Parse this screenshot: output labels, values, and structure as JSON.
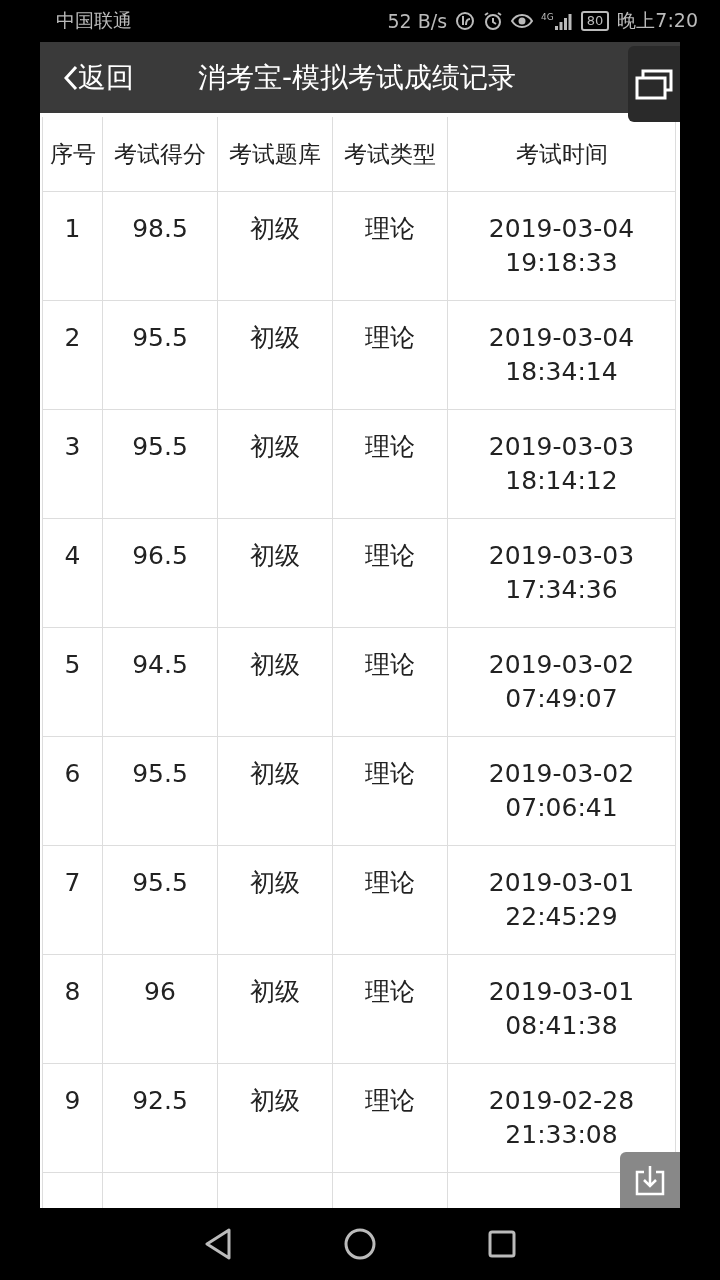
{
  "status_bar": {
    "carrier": "中国联通",
    "speed": "52 B/s",
    "network": "4G",
    "battery": "80",
    "time": "晚上7:20"
  },
  "header": {
    "back": "返回",
    "title": "消考宝-模拟考试成绩记录"
  },
  "table": {
    "columns": [
      "序号",
      "考试得分",
      "考试题库",
      "考试类型",
      "考试时间"
    ],
    "rows": [
      {
        "no": "1",
        "score": "98.5",
        "bank": "初级",
        "type": "理论",
        "date": "2019-03-04",
        "time": "19:18:33"
      },
      {
        "no": "2",
        "score": "95.5",
        "bank": "初级",
        "type": "理论",
        "date": "2019-03-04",
        "time": "18:34:14"
      },
      {
        "no": "3",
        "score": "95.5",
        "bank": "初级",
        "type": "理论",
        "date": "2019-03-03",
        "time": "18:14:12"
      },
      {
        "no": "4",
        "score": "96.5",
        "bank": "初级",
        "type": "理论",
        "date": "2019-03-03",
        "time": "17:34:36"
      },
      {
        "no": "5",
        "score": "94.5",
        "bank": "初级",
        "type": "理论",
        "date": "2019-03-02",
        "time": "07:49:07"
      },
      {
        "no": "6",
        "score": "95.5",
        "bank": "初级",
        "type": "理论",
        "date": "2019-03-02",
        "time": "07:06:41"
      },
      {
        "no": "7",
        "score": "95.5",
        "bank": "初级",
        "type": "理论",
        "date": "2019-03-01",
        "time": "22:45:29"
      },
      {
        "no": "8",
        "score": "96",
        "bank": "初级",
        "type": "理论",
        "date": "2019-03-01",
        "time": "08:41:38"
      },
      {
        "no": "9",
        "score": "92.5",
        "bank": "初级",
        "type": "理论",
        "date": "2019-02-28",
        "time": "21:33:08"
      }
    ]
  }
}
